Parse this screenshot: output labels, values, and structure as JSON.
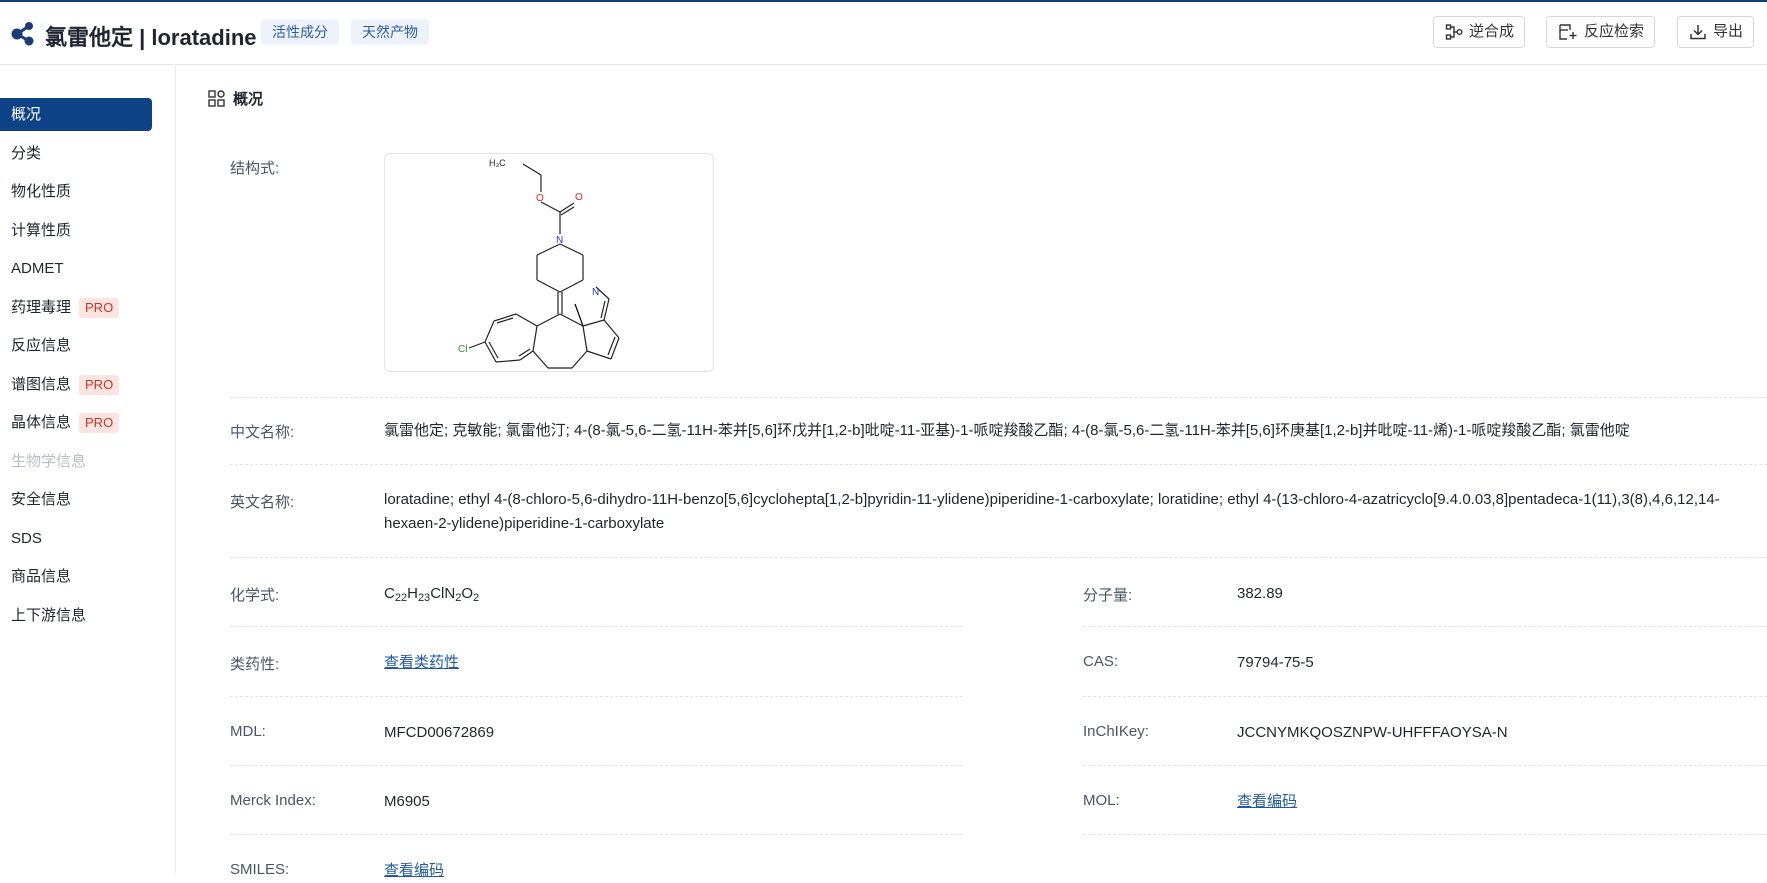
{
  "header": {
    "title": "氯雷他定 | loratadine",
    "tags": [
      "活性成分",
      "天然产物"
    ],
    "buttons": {
      "retrosynthesis": "逆合成",
      "reaction_search": "反应检索",
      "export": "导出"
    }
  },
  "sidebar": {
    "items": [
      {
        "label": "概况"
      },
      {
        "label": "分类"
      },
      {
        "label": "物化性质"
      },
      {
        "label": "计算性质"
      },
      {
        "label": "ADMET"
      },
      {
        "label": "药理毒理",
        "badge": "PRO"
      },
      {
        "label": "反应信息"
      },
      {
        "label": "谱图信息",
        "badge": "PRO"
      },
      {
        "label": "晶体信息",
        "badge": "PRO"
      },
      {
        "label": "生物学信息"
      },
      {
        "label": "安全信息"
      },
      {
        "label": "SDS"
      },
      {
        "label": "商品信息"
      },
      {
        "label": "上下游信息"
      }
    ]
  },
  "overview": {
    "section_title": "概况",
    "structure_label": "结构式:",
    "structure_atoms": {
      "h3c": "H₃C",
      "o1": "O",
      "o2": "O",
      "n_pip": "N",
      "n_pyr": "N",
      "cl": "Cl"
    },
    "cn_name_label": "中文名称:",
    "cn_name": "氯雷他定; 克敏能; 氯雷他汀; 4-(8-氯-5,6-二氢-11H-苯并[5,6]环戊并[1,2-b]吡啶-11-亚基)-1-哌啶羧酸乙酯; 4-(8-氯-5,6-二氢-11H-苯并[5,6]环庚基[1,2-b]并吡啶-11-烯)-1-哌啶羧酸乙酯; 氯雷他啶",
    "en_name_label": "英文名称:",
    "en_name": "loratadine; ethyl 4-(8-chloro-5,6-dihydro-11H-benzo[5,6]cyclohepta[1,2-b]pyridin-11-ylidene)piperidine-1-carboxylate; loratidine; ethyl 4-(13-chloro-4-azatricyclo[9.4.0.03,8]pentadeca-1(11),3(8),4,6,12,14-hexaen-2-ylidene)piperidine-1-carboxylate",
    "formula_label": "化学式:",
    "formula": {
      "c": "C",
      "c_n": "22",
      "h": "H",
      "h_n": "23",
      "cln": "ClN",
      "n_n": "2",
      "o": "O",
      "o_n": "2"
    },
    "mw_label": "分子量:",
    "mw": "382.89",
    "druglike_label": "类药性:",
    "druglike_link": "查看类药性",
    "cas_label": "CAS:",
    "cas": "79794-75-5",
    "mdl_label": "MDL:",
    "mdl": "MFCD00672869",
    "inchikey_label": "InChIKey:",
    "inchikey": "JCCNYMKQOSZNPW-UHFFFAOYSA-N",
    "merck_label": "Merck Index:",
    "merck": "M6905",
    "mol_label": "MOL:",
    "mol_link": "查看编码",
    "smiles_label": "SMILES:",
    "smiles_link": "查看编码"
  }
}
